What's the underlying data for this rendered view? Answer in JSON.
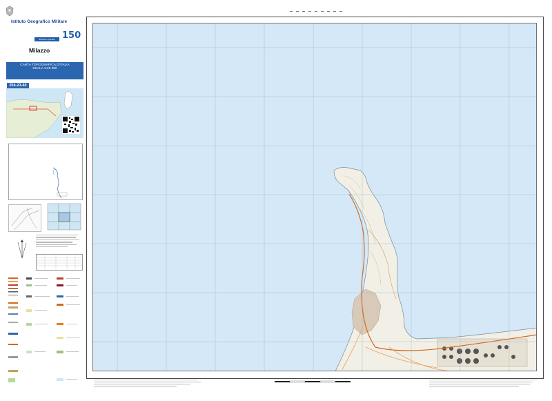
{
  "header": {
    "institute": "Istituto Geografico Militare",
    "edition_label": "Edizione speciale",
    "logo_text": "150"
  },
  "sheet": {
    "title": "Milazzo",
    "series_line1": "CARTA TOPOGRAFICA D'ITALIA",
    "series_line2": "SCALA 1:25 000",
    "code": "25k-23-40"
  },
  "colors": {
    "sea": "#d4e8f7",
    "land": "#f2efe6",
    "grid": "#9cb6cc",
    "road": "#d2691e",
    "blue_box": "#2b66b0"
  },
  "icons": [
    "emblem-icon",
    "qr-code-icon",
    "north-arrow-icon",
    "scale-bar-icon"
  ]
}
